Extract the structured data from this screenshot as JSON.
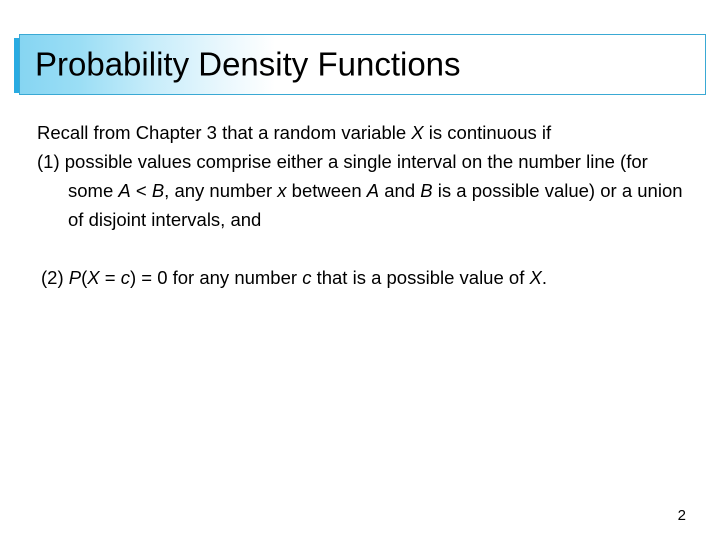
{
  "slide": {
    "title": "Probability Density Functions",
    "page_number": "2",
    "colors": {
      "title_accent_bar": "#29abe2",
      "title_gradient_start": "#86d5f2",
      "title_gradient_end": "#ffffff",
      "title_border": "#3aa9d4",
      "text": "#000000",
      "background": "#ffffff"
    }
  },
  "body": {
    "intro": {
      "seg1": "Recall from Chapter 3 that a random variable ",
      "var1": "X",
      "seg2": " is continuous if"
    },
    "item1": {
      "marker": "(1) ",
      "seg1": "possible values comprise either a single interval on the number line (for some ",
      "var1": "A",
      "seg2": " < ",
      "var2": "B",
      "seg3": ", any number ",
      "var3": "x",
      "seg4": " between ",
      "var4": "A",
      "seg5": " and ",
      "var5": "B",
      "seg6": " is a possible value) or a union of disjoint intervals, and"
    },
    "item2": {
      "marker": "(2) ",
      "var1": "P",
      "seg1": "(",
      "var2": "X",
      "seg2": " = ",
      "var3": "c",
      "seg3": ") = 0 for any number ",
      "var4": "c",
      "seg4": " that is a possible value of ",
      "var5": "X",
      "seg5": "."
    }
  }
}
